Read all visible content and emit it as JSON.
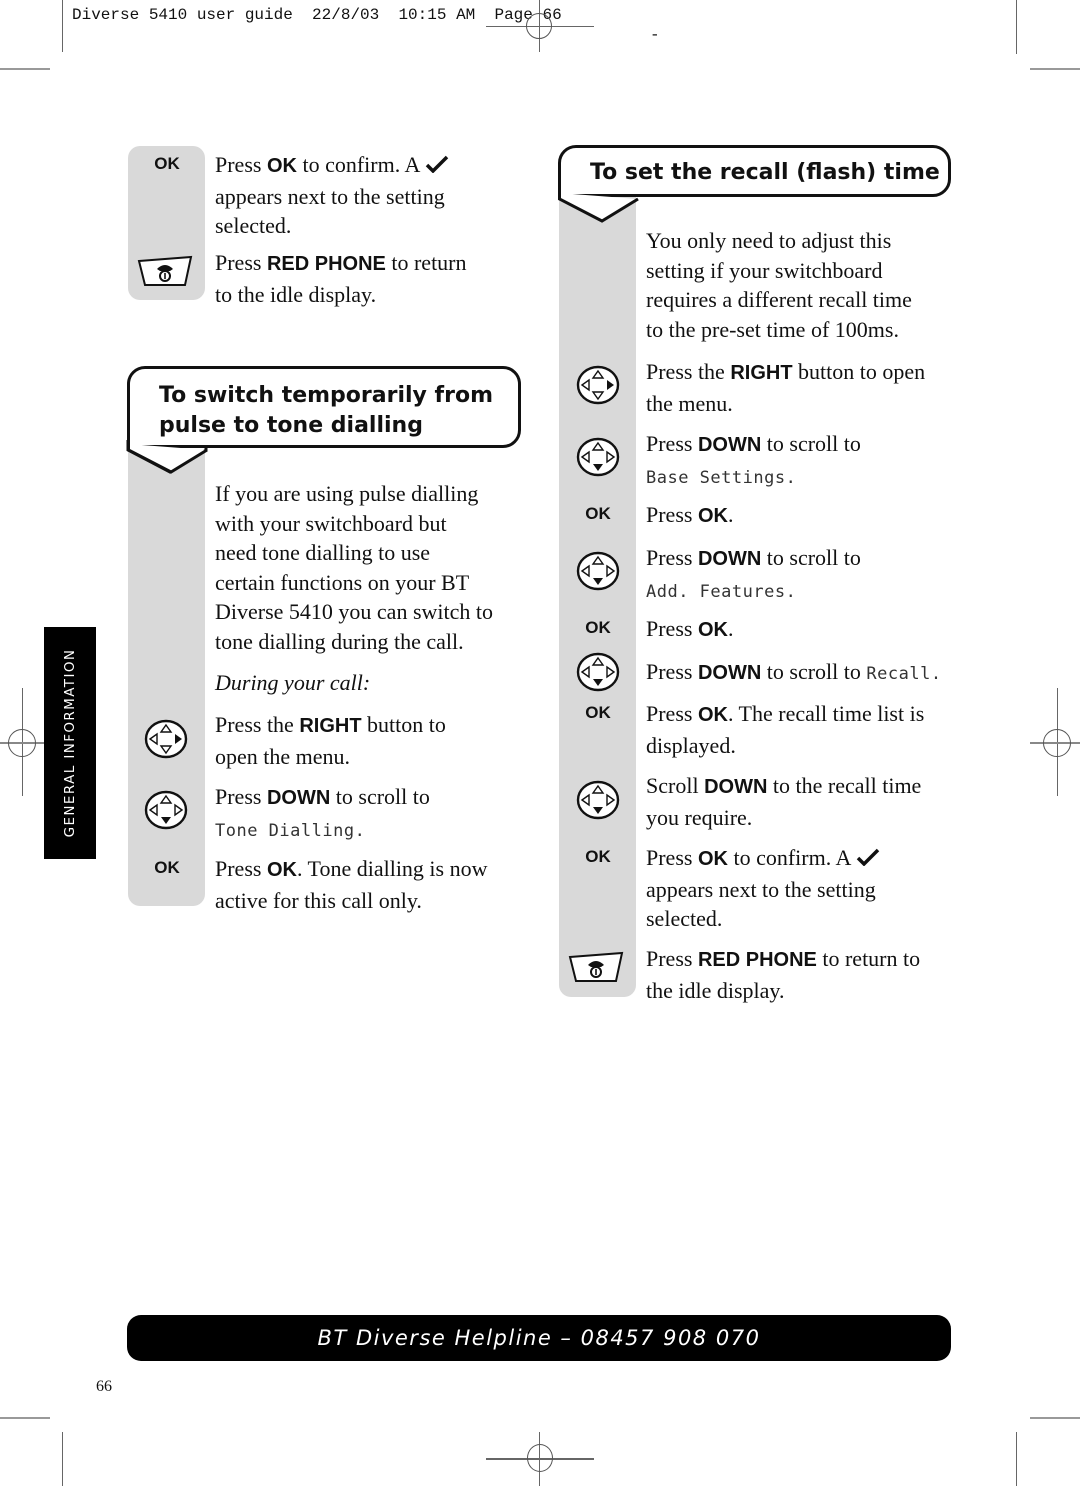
{
  "slug": {
    "text": "Diverse 5410 user guide  22/8/03  10:15 AM  Page 66",
    "dash": "-"
  },
  "side_tab": {
    "label": "GENERAL INFORMATION"
  },
  "left": {
    "top_steps": [
      {
        "icon": "ok",
        "icon_label": "OK",
        "pre": "Press ",
        "key": "OK",
        "post": " to confirm. A ",
        "line2": "appears next to the setting",
        "line3": "selected."
      },
      {
        "icon": "red-phone",
        "pre": "Press ",
        "key": "RED PHONE",
        "post": " to return",
        "line2": "to the idle display."
      }
    ],
    "section": {
      "heading_line1": "To switch temporarily from",
      "heading_line2": "pulse to tone dialling",
      "intro": [
        "If you are using pulse dialling",
        "with your switchboard but",
        "need tone dialling to use",
        "certain functions on your BT",
        "Diverse 5410 you can switch to",
        "tone dialling during the call."
      ],
      "subheading": "During your call:",
      "steps": [
        {
          "icon": "dpad-right",
          "pre": "Press the ",
          "key": "RIGHT",
          "post": " button to",
          "line2": "open the menu."
        },
        {
          "icon": "dpad-down",
          "pre": "Press ",
          "key": "DOWN",
          "post": " to scroll to",
          "lcd": "Tone Dialling",
          "lcd_suffix": "."
        },
        {
          "icon": "ok",
          "icon_label": "OK",
          "pre": "Press ",
          "key": "OK",
          "post": ". Tone dialling is now",
          "line2": "active for this call only."
        }
      ]
    }
  },
  "right": {
    "section": {
      "heading": "To set the recall (flash) time",
      "intro": [
        "You only need to adjust this",
        "setting if your switchboard",
        "requires a different recall time",
        "to the pre-set time of 100ms."
      ],
      "steps": [
        {
          "icon": "dpad-right",
          "pre": "Press the ",
          "key": "RIGHT",
          "post": " button to open",
          "line2": "the menu."
        },
        {
          "icon": "dpad-down",
          "pre": "Press ",
          "key": "DOWN",
          "post": " to scroll to",
          "lcd": "Base Settings",
          "lcd_suffix": "."
        },
        {
          "icon": "ok",
          "icon_label": "OK",
          "pre": "Press ",
          "key": "OK",
          "post": "."
        },
        {
          "icon": "dpad-down",
          "pre": "Press ",
          "key": "DOWN",
          "post": " to scroll to",
          "lcd": "Add. Features",
          "lcd_suffix": "."
        },
        {
          "icon": "ok",
          "icon_label": "OK",
          "pre": "Press ",
          "key": "OK",
          "post": "."
        },
        {
          "icon": "dpad-down",
          "pre": "Press ",
          "key": "DOWN",
          "post": " to scroll to ",
          "lcd": "Recall",
          "lcd_suffix": "."
        },
        {
          "icon": "ok",
          "icon_label": "OK",
          "pre": "Press ",
          "key": "OK",
          "post": ". The recall time list is",
          "line2": "displayed."
        },
        {
          "icon": "dpad-down",
          "pre": "Scroll ",
          "key": "DOWN",
          "post": " to the recall time",
          "line2": "you require."
        },
        {
          "icon": "ok",
          "icon_label": "OK",
          "pre": "Press ",
          "key": "OK",
          "post": " to confirm. A ",
          "line2": "appears next to the setting",
          "line3": "selected."
        },
        {
          "icon": "red-phone",
          "pre": "Press ",
          "key": "RED PHONE",
          "post": " to return to",
          "line2": "the idle display."
        }
      ]
    }
  },
  "footer": {
    "helpline": "BT Diverse Helpline – 08457 908 070",
    "page_number": "66"
  },
  "colors": {
    "icon_column": "#d9d9d9",
    "bar": "#000000"
  }
}
